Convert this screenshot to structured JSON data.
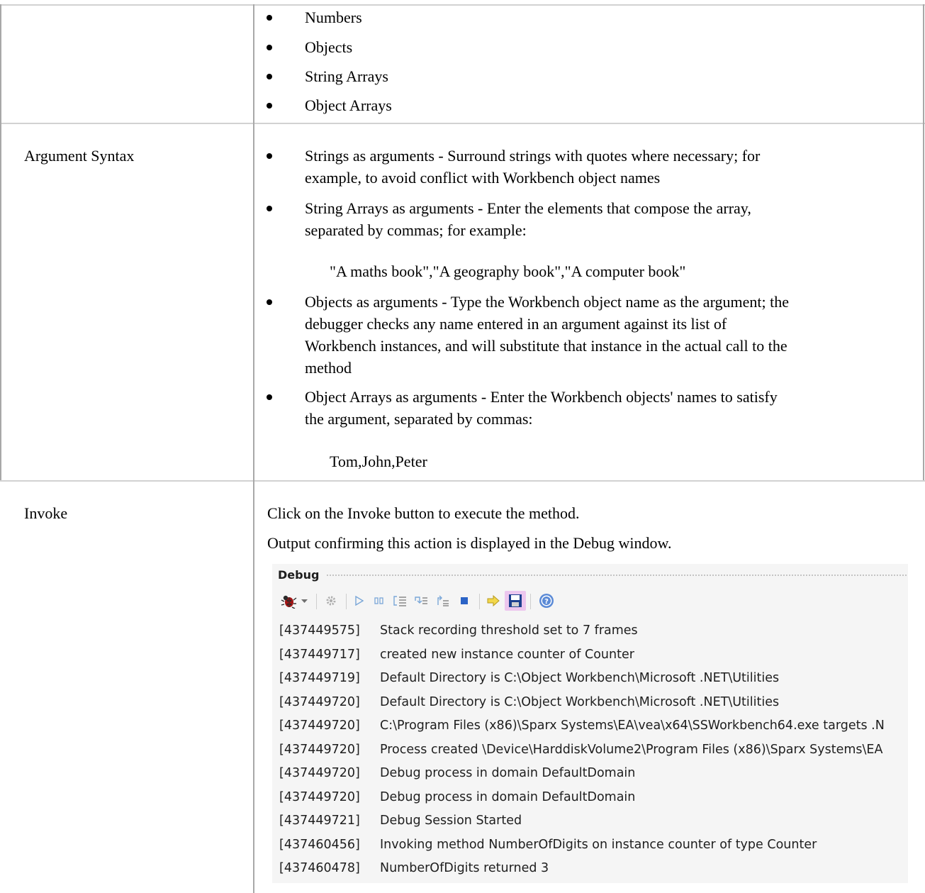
{
  "row1": {
    "items": [
      "Numbers",
      "Objects",
      "String Arrays",
      "Object Arrays"
    ]
  },
  "row2": {
    "label": "Argument Syntax",
    "bullets": [
      {
        "lines": [
          "Strings as arguments - Surround strings with quotes where necessary; for",
          "example, to avoid conflict with Workbench object names"
        ]
      },
      {
        "lines": [
          "String Arrays as arguments - Enter the elements that compose the array,",
          "separated by commas; for example:"
        ]
      },
      {
        "lines": [
          "Objects as arguments - Type the Workbench object name as the argument; the",
          "debugger checks any name entered in an argument against its list of",
          "Workbench instances, and will substitute that instance in the actual call to the",
          "method"
        ]
      },
      {
        "lines": [
          "Object Arrays as arguments - Enter the Workbench objects' names to satisfy",
          "the argument, separated by commas:"
        ]
      }
    ],
    "example1": "\"A maths book\",\"A geography book\",\"A computer book\"",
    "example2": "Tom,John,Peter"
  },
  "row3": {
    "label": "Invoke",
    "para1": "Click on the Invoke button to execute the method.",
    "para2": "Output confirming this action is displayed in the Debug window."
  },
  "debug": {
    "title": "Debug",
    "toolbar_icons": [
      "bug-icon",
      "dropdown-arrow-icon",
      "settings-gear-icon",
      "run-icon",
      "pause-icon",
      "step-into-icon",
      "step-over-icon",
      "step-out-icon",
      "stop-icon",
      "arrow-right-icon",
      "save-icon",
      "help-icon"
    ],
    "log": [
      {
        "ts": "[437449575]",
        "msg": "Stack recording threshold set to 7 frames"
      },
      {
        "ts": "[437449717]",
        "msg": "created new instance counter of Counter"
      },
      {
        "ts": "[437449719]",
        "msg": "Default Directory is C:\\Object Workbench\\Microsoft .NET\\Utilities"
      },
      {
        "ts": "[437449720]",
        "msg": "Default Directory is C:\\Object Workbench\\Microsoft .NET\\Utilities"
      },
      {
        "ts": "[437449720]",
        "msg": "C:\\Program Files (x86)\\Sparx Systems\\EA\\vea\\x64\\SSWorkbench64.exe targets .N"
      },
      {
        "ts": "[437449720]",
        "msg": "Process created \\Device\\HarddiskVolume2\\Program Files (x86)\\Sparx Systems\\EA"
      },
      {
        "ts": "[437449720]",
        "msg": "Debug process in domain DefaultDomain"
      },
      {
        "ts": "[437449720]",
        "msg": "Debug process in domain DefaultDomain"
      },
      {
        "ts": "[437449721]",
        "msg": "Debug Session Started"
      },
      {
        "ts": "[437460456]",
        "msg": "Invoking method NumberOfDigits on instance counter of type Counter"
      },
      {
        "ts": "[437460478]",
        "msg": "NumberOfDigits returned 3"
      }
    ]
  }
}
